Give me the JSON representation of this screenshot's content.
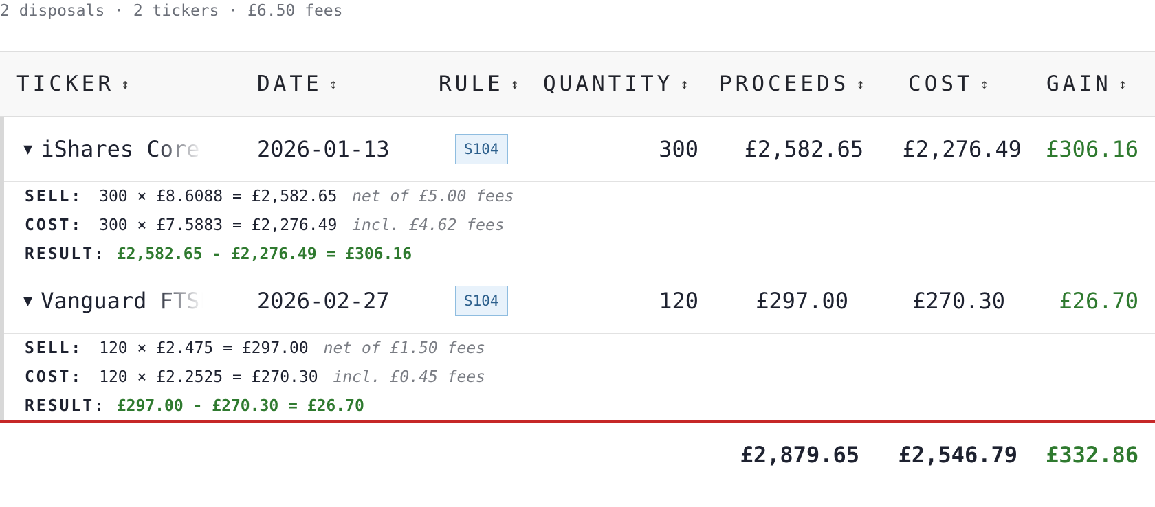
{
  "summary": "2 disposals · 2 tickers · £6.50 fees",
  "columns": [
    {
      "label": "TICKER",
      "sort_icon": "↕"
    },
    {
      "label": "DATE",
      "sort_icon": "↕"
    },
    {
      "label": "RULE",
      "sort_icon": "↕"
    },
    {
      "label": "QUANTITY",
      "sort_icon": "↕"
    },
    {
      "label": "PROCEEDS",
      "sort_icon": "↕"
    },
    {
      "label": "COST",
      "sort_icon": "↕"
    },
    {
      "label": "GAIN",
      "sort_icon": "↕"
    }
  ],
  "rows": [
    {
      "toggle": "▼",
      "ticker": "iShares Core",
      "date": "2026-01-13",
      "rule": "S104",
      "quantity": "300",
      "proceeds": "£2,582.65",
      "cost": "£2,276.49",
      "gain": "£306.16",
      "detail": {
        "sell_label": "SELL:",
        "sell_calc": "300 × £8.6088 = £2,582.65",
        "sell_note": "net of £5.00 fees",
        "cost_label": "COST:",
        "cost_calc": "300 × £7.5883 = £2,276.49",
        "cost_note": "incl. £4.62 fees",
        "result_label": "RESULT:",
        "result_calc": "£2,582.65 - £2,276.49 = £306.16"
      }
    },
    {
      "toggle": "▼",
      "ticker": "Vanguard FTSE",
      "date": "2026-02-27",
      "rule": "S104",
      "quantity": "120",
      "proceeds": "£297.00",
      "cost": "£270.30",
      "gain": "£26.70",
      "detail": {
        "sell_label": "SELL:",
        "sell_calc": "120 × £2.475 = £297.00",
        "sell_note": "net of £1.50 fees",
        "cost_label": "COST:",
        "cost_calc": "120 × £2.2525 = £270.30",
        "cost_note": "incl. £0.45 fees",
        "result_label": "RESULT:",
        "result_calc": "£297.00 - £270.30 = £26.70"
      }
    }
  ],
  "totals": {
    "proceeds": "£2,879.65",
    "cost": "£2,546.79",
    "gain": "£332.86"
  },
  "colors": {
    "gain": "#2f7a2f",
    "total_border": "#c62828",
    "badge_bg": "#e8f2fb",
    "badge_border": "#8fbde0"
  }
}
